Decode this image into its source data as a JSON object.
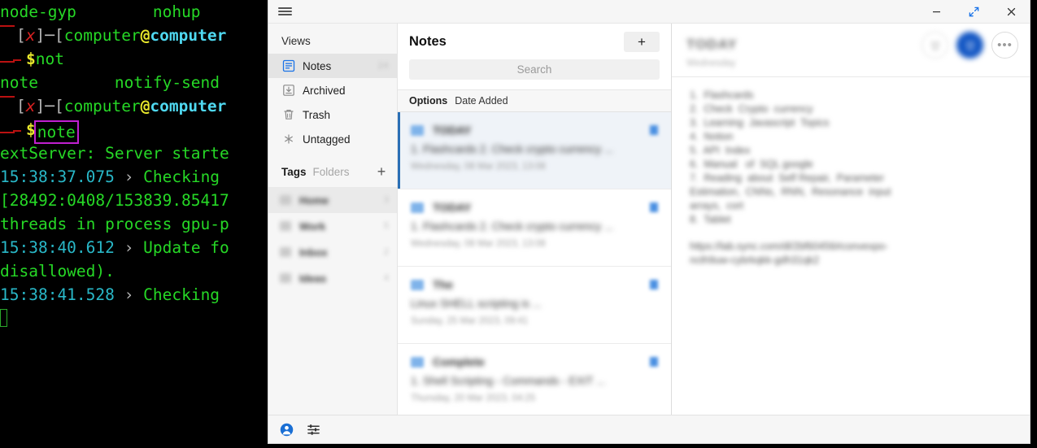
{
  "terminal": {
    "lines": [
      {
        "segments": [
          {
            "text": "node-gyp",
            "cls": "t-green"
          },
          {
            "text": "        ",
            "cls": "t-green"
          },
          {
            "text": "nohup",
            "cls": "t-green"
          }
        ]
      },
      {
        "prompt": true,
        "segments": [
          {
            "text": "[",
            "cls": "t-gray"
          },
          {
            "text": "x",
            "cls": "t-redi"
          },
          {
            "text": "]",
            "cls": "t-gray"
          },
          {
            "text": "─",
            "cls": "t-gray"
          },
          {
            "text": "[",
            "cls": "t-gray"
          },
          {
            "text": "computer",
            "cls": "t-green"
          },
          {
            "text": "@",
            "cls": "t-yellow"
          },
          {
            "text": "computer",
            "cls": "t-lcyan"
          }
        ]
      },
      {
        "cmd": true,
        "segments": [
          {
            "text": "$",
            "cls": "t-yellow"
          },
          {
            "text": "not",
            "cls": "t-green"
          }
        ]
      },
      {
        "segments": [
          {
            "text": "note",
            "cls": "t-green"
          },
          {
            "text": "        ",
            "cls": "t-green"
          },
          {
            "text": "notify-send",
            "cls": "t-green"
          }
        ]
      },
      {
        "prompt": true,
        "segments": [
          {
            "text": "[",
            "cls": "t-gray"
          },
          {
            "text": "x",
            "cls": "t-redi"
          },
          {
            "text": "]",
            "cls": "t-gray"
          },
          {
            "text": "─",
            "cls": "t-gray"
          },
          {
            "text": "[",
            "cls": "t-gray"
          },
          {
            "text": "computer",
            "cls": "t-green"
          },
          {
            "text": "@",
            "cls": "t-yellow"
          },
          {
            "text": "computer",
            "cls": "t-lcyan"
          }
        ]
      },
      {
        "cmd": true,
        "highlight": "note",
        "segments": [
          {
            "text": "$",
            "cls": "t-yellow"
          }
        ]
      },
      {
        "segments": [
          {
            "text": "extServer: Server starte",
            "cls": "t-green"
          }
        ]
      },
      {
        "segments": [
          {
            "text": "15:38:37.075",
            "cls": "t-cyan"
          },
          {
            "text": " › ",
            "cls": "t-gray"
          },
          {
            "text": "Checking",
            "cls": "t-green"
          }
        ]
      },
      {
        "segments": [
          {
            "text": "[28492:0408/153839.85417",
            "cls": "t-green"
          }
        ]
      },
      {
        "segments": [
          {
            "text": "threads in process gpu-p",
            "cls": "t-green"
          }
        ]
      },
      {
        "segments": [
          {
            "text": "15:38:40.612",
            "cls": "t-cyan"
          },
          {
            "text": " › ",
            "cls": "t-gray"
          },
          {
            "text": "Update fo",
            "cls": "t-green"
          }
        ]
      },
      {
        "segments": [
          {
            "text": "disallowed).",
            "cls": "t-green"
          }
        ]
      },
      {
        "segments": [
          {
            "text": "15:38:41.528",
            "cls": "t-cyan"
          },
          {
            "text": " › ",
            "cls": "t-gray"
          },
          {
            "text": "Checking",
            "cls": "t-green"
          }
        ]
      },
      {
        "cursor": true,
        "segments": []
      }
    ]
  },
  "window": {
    "titlebar": {
      "menu_icon": "hamburger-icon",
      "minimize_label": "—",
      "maximize_label": "maximize-icon",
      "close_label": "✕"
    },
    "bottombar": {
      "account_icon": "account-icon",
      "settings_icon": "settings-sliders-icon"
    }
  },
  "sidebar": {
    "views_label": "Views",
    "items": [
      {
        "label": "Notes",
        "icon": "notes-icon",
        "count": "24",
        "selected": true
      },
      {
        "label": "Archived",
        "icon": "archive-icon",
        "count": "",
        "selected": false
      },
      {
        "label": "Trash",
        "icon": "trash-icon",
        "count": "",
        "selected": false
      },
      {
        "label": "Untagged",
        "icon": "untagged-icon",
        "count": "",
        "selected": false
      }
    ],
    "tags_tab": "Tags",
    "folders_tab": "Folders",
    "add_tag_label": "+",
    "tags": [
      {
        "name": "Home",
        "count": "3",
        "highlighted": true
      },
      {
        "name": "Work",
        "count": "5",
        "highlighted": false
      },
      {
        "name": "Inbox",
        "count": "2",
        "highlighted": false
      },
      {
        "name": "Ideas",
        "count": "4",
        "highlighted": false
      }
    ]
  },
  "notelist": {
    "title": "Notes",
    "add_button_label": "+",
    "search_placeholder": "Search",
    "search_value": "",
    "options_label": "Options",
    "sort_value": "Date Added",
    "rows": [
      {
        "title": "TODAY",
        "preview": "1. Flashcards 2. Check crypto currency ...",
        "date": "Wednesday, 08 Mar 2023, 13:08",
        "selected": true
      },
      {
        "title": "TODAY",
        "preview": "1. Flashcards 2. Check crypto currency ...",
        "date": "Wednesday, 08 Mar 2023, 13:08",
        "selected": false
      },
      {
        "title": "The",
        "preview": "Linux SHELL scripting is ...",
        "date": "Sunday, 25 Mar 2023, 09:41",
        "selected": false
      },
      {
        "title": "Complete",
        "preview": "1. Shell Scripting - Commands - EXIT ...",
        "date": "Thursday, 20 Mar 2023, 04:25",
        "selected": false
      }
    ]
  },
  "editor": {
    "title": "TODAY",
    "subtitle": "Wednesday",
    "actions": [
      {
        "icon": "trash-outline-icon",
        "style": "blurred"
      },
      {
        "icon": "trash-filled-icon",
        "style": "active"
      },
      {
        "icon": "more-options-icon",
        "style": "plain",
        "glyph": "•••"
      }
    ],
    "content_lines": [
      "1.  Flashcards",
      "2.  Check  Crypto  currency",
      "3.  Learning  Javascript  Topics",
      "4.  Notion",
      "5.  API  Index",
      "6.  Manual   of  SQL google",
      "7.  Reading  about  Self Repair,  Parameter",
      "Estimation,  CNNs,  RNN,  Resonance  input",
      "arrays,  cort",
      "8.  Tablet"
    ],
    "footer_lines": [
      "https://lab.sync.com/dl/2bf60456#convexpo-",
      "ncth9uw-cybrkqkk-gdh31qk2"
    ]
  }
}
